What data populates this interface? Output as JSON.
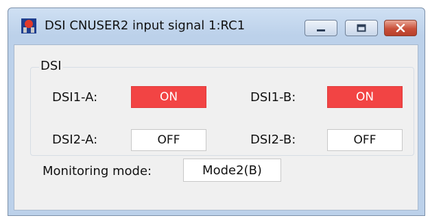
{
  "window": {
    "title": "DSI CNUSER2 input signal 1:RC1",
    "icon": "app-flag-icon",
    "controls": [
      "minimize-icon",
      "maximize-icon",
      "close-icon"
    ]
  },
  "dsi_group": {
    "label": "DSI",
    "signals": [
      {
        "label": "DSI1-A:",
        "state": "ON"
      },
      {
        "label": "DSI1-B:",
        "state": "ON"
      },
      {
        "label": "DSI2-A:",
        "state": "OFF"
      },
      {
        "label": "DSI2-B:",
        "state": "OFF"
      }
    ]
  },
  "monitoring": {
    "label": "Monitoring mode:",
    "value": "Mode2(B)"
  },
  "colors": {
    "on_background": "#f24444",
    "off_background": "#ffffff",
    "titlebar": "#bcd1ea",
    "close_button": "#c9503a"
  }
}
